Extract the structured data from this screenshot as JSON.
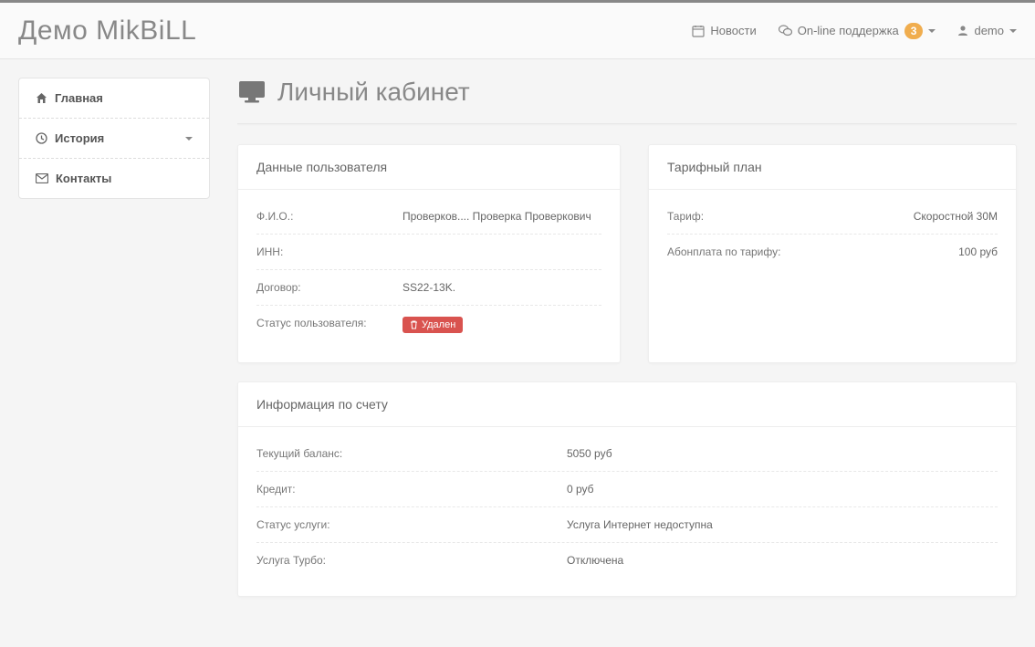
{
  "brand": "Демо MikBiLL",
  "nav": {
    "news": "Новости",
    "support": "On-line поддержка",
    "support_badge": "3",
    "user": "demo"
  },
  "sidebar": {
    "items": [
      {
        "label": "Главная"
      },
      {
        "label": "История"
      },
      {
        "label": "Контакты"
      }
    ]
  },
  "page_title": "Личный кабинет",
  "user_data_panel": {
    "title": "Данные пользователя",
    "rows": {
      "fio_label": "Ф.И.О.:",
      "fio_value": "Проверков.... Проверка Проверкович",
      "inn_label": "ИНН:",
      "inn_value": "",
      "contract_label": "Договор:",
      "contract_value": "SS22-13K.",
      "status_label": "Статус пользователя:",
      "status_value": "Удален"
    }
  },
  "tariff_panel": {
    "title": "Тарифный план",
    "rows": {
      "tariff_label": "Тариф:",
      "tariff_value": "Скоростной 30M",
      "fee_label": "Абонплата по тарифу:",
      "fee_value": "100 руб"
    }
  },
  "account_panel": {
    "title": "Информация по счету",
    "rows": {
      "balance_label": "Текущий баланс:",
      "balance_value": "5050 руб",
      "credit_label": "Кредит:",
      "credit_value": "0 руб",
      "service_label": "Статус услуги:",
      "service_value": "Услуга Интернет недоступна",
      "turbo_label": "Услуга Турбо:",
      "turbo_value": "Отключена"
    }
  }
}
